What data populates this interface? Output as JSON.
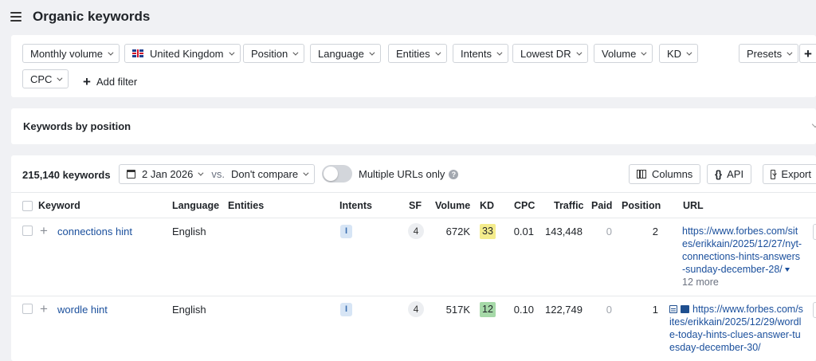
{
  "header": {
    "title": "Organic keywords"
  },
  "filters": {
    "monthly_volume": "Monthly volume",
    "country": "United Kingdom",
    "position": "Position",
    "language": "Language",
    "entities": "Entities",
    "intents": "Intents",
    "lowest_dr": "Lowest DR",
    "volume": "Volume",
    "kd": "KD",
    "presets": "Presets",
    "plus": "+",
    "cpc": "CPC",
    "add_filter": "Add filter"
  },
  "keywords_by_position": {
    "title": "Keywords by position"
  },
  "toolbar": {
    "count": "215,140 keywords",
    "date": "2 Jan 2026",
    "vs": "vs.",
    "compare": "Don't compare",
    "multiple_urls": "Multiple URLs only",
    "help": "?",
    "columns": "Columns",
    "api_icon": "{}",
    "api": "API",
    "export": "Export"
  },
  "table": {
    "headers": {
      "keyword": "Keyword",
      "language": "Language",
      "entities": "Entities",
      "intents": "Intents",
      "sf": "SF",
      "volume": "Volume",
      "kd": "KD",
      "cpc": "CPC",
      "traffic": "Traffic",
      "paid": "Paid",
      "position": "Position",
      "url": "URL"
    },
    "rows": [
      {
        "keyword": "connections hint",
        "language": "English",
        "intent": "I",
        "sf": "4",
        "volume": "672K",
        "kd": "33",
        "kd_color": "#f4ec8c",
        "cpc": "0.01",
        "traffic": "143,448",
        "paid": "0",
        "position": "2",
        "url": "https://www.forbes.com/sites/erikkain/2025/12/27/nyt-connections-hints-answers-sunday-december-28/",
        "more": "12 more"
      },
      {
        "keyword": "wordle hint",
        "language": "English",
        "intent": "I",
        "sf": "4",
        "volume": "517K",
        "kd": "12",
        "kd_color": "#a6d9a8",
        "cpc": "0.10",
        "traffic": "122,749",
        "paid": "0",
        "position": "1",
        "url": "https://www.forbes.com/sites/erikkain/2025/12/29/wordle-today-hints-clues-answer-tuesday-december-30/"
      }
    ]
  }
}
